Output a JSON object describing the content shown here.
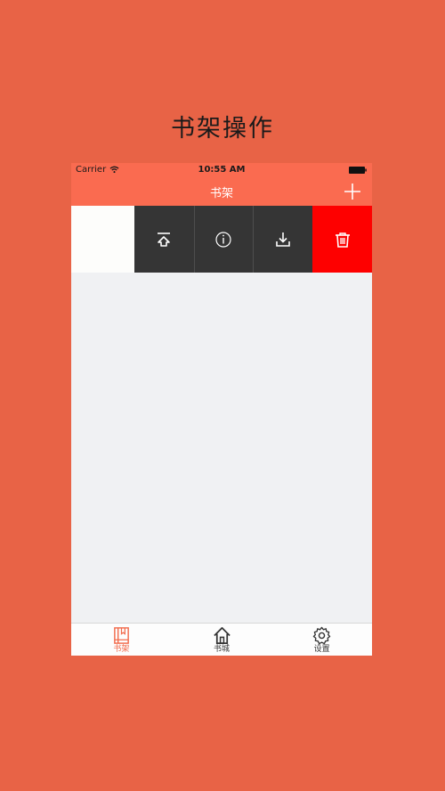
{
  "promo": {
    "title": "书架操作"
  },
  "status_bar": {
    "carrier": "Carrier",
    "time": "10:55 AM"
  },
  "nav": {
    "title": "书架"
  },
  "row_actions": [
    {
      "id": "move-top",
      "icon": "move-to-top-icon"
    },
    {
      "id": "info",
      "icon": "info-icon"
    },
    {
      "id": "download",
      "icon": "download-icon"
    },
    {
      "id": "delete",
      "icon": "trash-icon"
    }
  ],
  "tabs": [
    {
      "label": "书架",
      "icon": "bookshelf-icon",
      "active": true
    },
    {
      "label": "书城",
      "icon": "home-icon",
      "active": false
    },
    {
      "label": "设置",
      "icon": "gear-icon",
      "active": false
    }
  ],
  "colors": {
    "accent": "#fa6b50",
    "background": "#e86346",
    "delete": "#fe0000",
    "action": "#353535"
  }
}
